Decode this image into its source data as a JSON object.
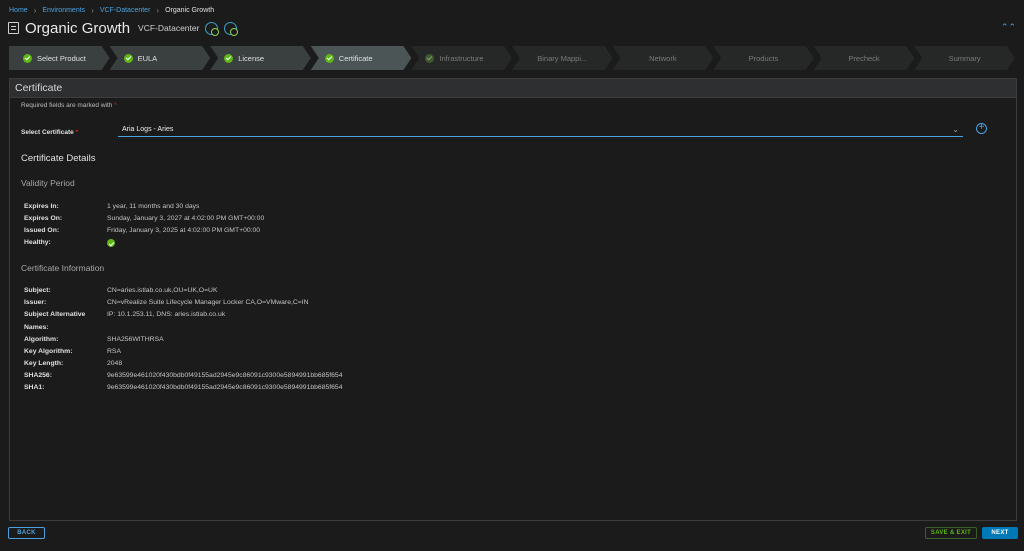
{
  "breadcrumb": [
    {
      "label": "Home",
      "link": true
    },
    {
      "label": "Environments",
      "link": true
    },
    {
      "label": "VCF-Datacenter",
      "link": true
    },
    {
      "label": "Organic Growth",
      "link": false
    }
  ],
  "header": {
    "title": "Organic Growth",
    "environment": "VCF-Datacenter"
  },
  "wizard": {
    "steps": [
      {
        "label": "Select Product",
        "state": "done"
      },
      {
        "label": "EULA",
        "state": "done"
      },
      {
        "label": "License",
        "state": "done"
      },
      {
        "label": "Certificate",
        "state": "active"
      },
      {
        "label": "Infrastructure",
        "state": "pending-icon"
      },
      {
        "label": "Binary Mappi...",
        "state": "pending"
      },
      {
        "label": "Network",
        "state": "pending"
      },
      {
        "label": "Products",
        "state": "pending"
      },
      {
        "label": "Precheck",
        "state": "pending"
      },
      {
        "label": "Summary",
        "state": "pending"
      }
    ]
  },
  "panel": {
    "title": "Certificate",
    "required_note": "Required fields are marked with",
    "required_star": "*",
    "select_label": "Select Certificate",
    "select_value": "Aria Logs - Aries",
    "details_heading": "Certificate Details",
    "validity_heading": "Validity Period",
    "validity": [
      {
        "key": "Expires In:",
        "value": "1 year, 11 months and 30 days"
      },
      {
        "key": "Expires On:",
        "value": "Sunday, January 3, 2027 at 4:02:00 PM GMT+00:00"
      },
      {
        "key": "Issued On:",
        "value": "Friday, January 3, 2025 at 4:02:00 PM GMT+00:00"
      },
      {
        "key": "Healthy:",
        "value": ""
      }
    ],
    "info_heading": "Certificate Information",
    "info": [
      {
        "key": "Subject:",
        "value": "CN=aries.istlab.co.uk,OU=UK,O=UK"
      },
      {
        "key": "Issuer:",
        "value": "CN=vRealize Suite Lifecycle Manager Locker CA,O=VMware,C=IN"
      },
      {
        "key": "Subject Alternative",
        "value": "IP: 10.1.253.11, DNS: aries.istlab.co.uk"
      },
      {
        "key": "Names:",
        "value": ""
      },
      {
        "key": "Algorithm:",
        "value": "SHA256WITHRSA"
      },
      {
        "key": "Key Algorithm:",
        "value": "RSA"
      },
      {
        "key": "Key Length:",
        "value": "2048"
      },
      {
        "key": "SHA256:",
        "value": "9e63599e461020f430bdb0f49155ad2945e9c86091c9300e5894991bb685f654"
      },
      {
        "key": "SHA1:",
        "value": "9e63599e461020f430bdb0f49155ad2945e9c86091c9300e5894991bb685f654"
      }
    ]
  },
  "footer": {
    "back": "BACK",
    "save_exit": "SAVE & EXIT",
    "next": "NEXT"
  },
  "colors": {
    "accent": "#4aa3df",
    "success": "#5eb715",
    "primary": "#0079b8",
    "required": "#e62700"
  }
}
